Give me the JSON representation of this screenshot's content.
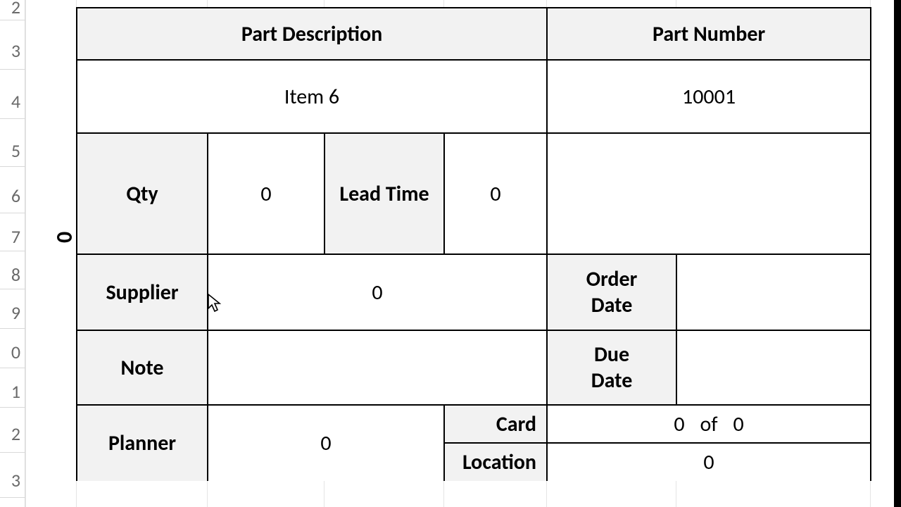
{
  "rowHeaders": [
    "2",
    "3",
    "4",
    "5",
    "6",
    "7",
    "8",
    "9",
    "0",
    "1",
    "2",
    "3"
  ],
  "side_label": "0",
  "headers": {
    "part_description": "Part Description",
    "part_number": "Part Number"
  },
  "values": {
    "part_description": "Item 6",
    "part_number": "10001",
    "qty_label": "Qty",
    "qty": "0",
    "lead_time_label": "Lead Time",
    "lead_time": "0",
    "supplier_label": "Supplier",
    "supplier": "0",
    "order_date_label": "Order Date",
    "order_date": "",
    "note_label": "Note",
    "note": "",
    "due_date_label": "Due Date",
    "due_date": "",
    "planner_label": "Planner",
    "planner": "0",
    "card_label": "Card",
    "card_n1": "0",
    "card_of": "of",
    "card_n2": "0",
    "location_label": "Location",
    "location": "0"
  }
}
